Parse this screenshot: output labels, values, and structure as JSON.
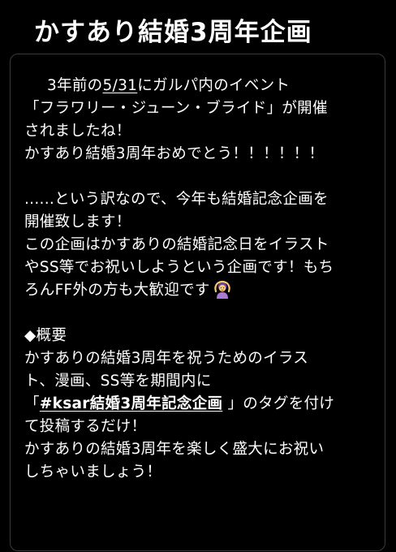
{
  "header": {
    "title": "かすあり結婚3周年企画"
  },
  "post": {
    "line1_prefix": "3年前の",
    "line1_date": "5/31",
    "line1_suffix": "にガルパ内のイベント",
    "line2": "「フラワリー・ジューン・ブライド」が開催",
    "line3": "されましたね！",
    "line4": "かすあり結婚3周年おめでとう！！！！！！",
    "line5": "......という訳なので、今年も結婚記念企画を",
    "line6": "開催致します！",
    "line7": "この企画はかすありの結婚記念日をイラスト",
    "line8": "やSS等でお祝いしようという企画です！もち",
    "line9": "ろんFF外の方も大歓迎です",
    "emoji": "woman-gesturing-ok-icon",
    "line10": "◆概要",
    "line11": "かすありの結婚3周年を祝うためのイラス",
    "line12": "ト、漫画、SS等を期間内に",
    "line13_open": "「",
    "line13_tag": "#ksar結婚3周年記念企画",
    "line13_close": " 」のタグを付け",
    "line14": "て投稿するだけ！",
    "line15": "かすありの結婚3周年を楽しく盛大にお祝い",
    "line16": "しちゃいましょう！"
  }
}
